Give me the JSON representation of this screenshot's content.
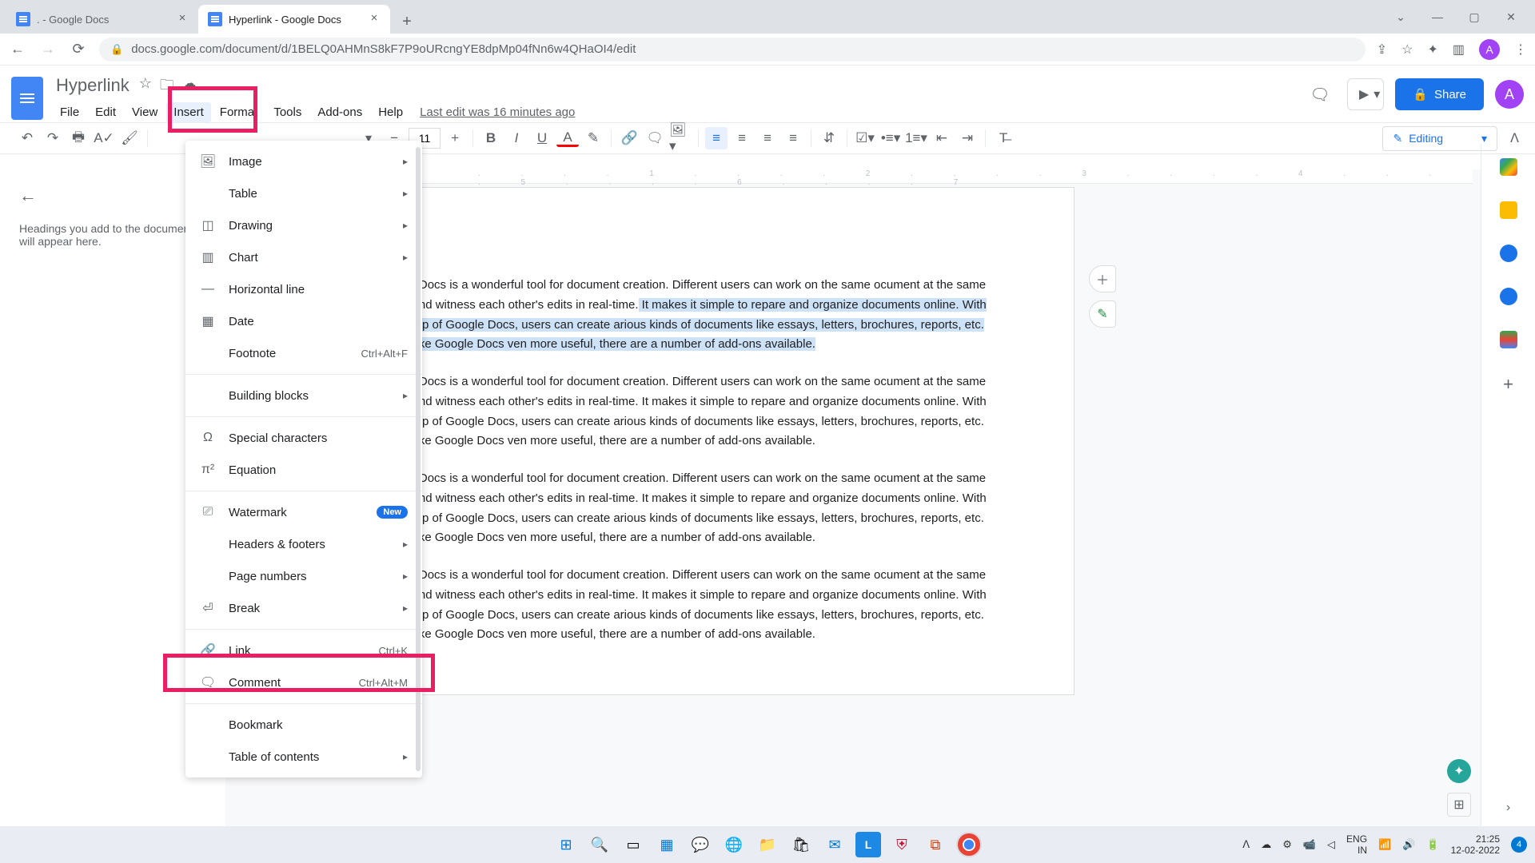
{
  "browser": {
    "tabs": [
      {
        "title": ". - Google Docs"
      },
      {
        "title": "Hyperlink - Google Docs"
      }
    ],
    "url": "docs.google.com/document/d/1BELQ0AHMnS8kF7P9oURcngYE8dpMp04fNn6w4QHaOI4/edit",
    "avatar_letter": "A"
  },
  "doc": {
    "title": "Hyperlink",
    "menus": [
      "File",
      "Edit",
      "View",
      "Insert",
      "Format",
      "Tools",
      "Add-ons",
      "Help"
    ],
    "active_menu_index": 3,
    "last_edit": "Last edit was 16 minutes ago",
    "share_label": "Share",
    "editing_label": "Editing",
    "outline_placeholder": "Headings you add to the document will appear here.",
    "font_size": "11",
    "avatar_letter": "A"
  },
  "insert_menu": {
    "items": [
      {
        "icon": "🖼",
        "label": "Image",
        "submenu": true
      },
      {
        "icon": "▦",
        "label": "Table",
        "submenu": true
      },
      {
        "icon": "⬚",
        "label": "Drawing",
        "submenu": true
      },
      {
        "icon": "📊",
        "label": "Chart",
        "submenu": true
      },
      {
        "icon": "—",
        "label": "Horizontal line"
      },
      {
        "icon": "📅",
        "label": "Date"
      },
      {
        "icon": "",
        "label": "Footnote",
        "shortcut": "Ctrl+Alt+F"
      }
    ],
    "sep1": true,
    "items2": [
      {
        "icon": "",
        "label": "Building blocks",
        "submenu": true
      }
    ],
    "sep2": true,
    "items3": [
      {
        "icon": "Ω",
        "label": "Special characters"
      },
      {
        "icon": "π²",
        "label": "Equation"
      }
    ],
    "sep3": true,
    "items4": [
      {
        "icon": "📄",
        "label": "Watermark",
        "badge": "New"
      },
      {
        "icon": "",
        "label": "Headers & footers",
        "submenu": true
      },
      {
        "icon": "",
        "label": "Page numbers",
        "submenu": true
      },
      {
        "icon": "⏎",
        "label": "Break",
        "submenu": true
      }
    ],
    "sep4": true,
    "items5": [
      {
        "icon": "🔗",
        "label": "Link",
        "shortcut": "Ctrl+K"
      },
      {
        "icon": "🗨",
        "label": "Comment",
        "shortcut": "Ctrl+Alt+M"
      }
    ],
    "sep5": true,
    "items6": [
      {
        "icon": "",
        "label": "Bookmark"
      },
      {
        "icon": "",
        "label": "Table of contents",
        "submenu": true
      }
    ]
  },
  "body": {
    "para_prefix_1": "oogle Docs is a wonderful tool for document creation. Different users can work on the same ocument at the same time and witness each other's edits in real-time.",
    "para_hl": " It makes it simple to repare and organize documents online. With the help of Google Docs, users can create arious kinds of documents like essays, letters, brochures, reports, etc. To make Google Docs ven more useful, there are a number of add-ons available.",
    "para_plain": "oogle Docs is a wonderful tool for document creation. Different users can work on the same ocument at the same time and witness each other's edits in real-time. It makes it simple to repare and organize documents online. With the help of Google Docs, users can create arious kinds of documents like essays, letters, brochures, reports, etc. To make Google Docs ven more useful, there are a number of add-ons available."
  },
  "taskbar": {
    "lang1": "ENG",
    "lang2": "IN",
    "time": "21:25",
    "date": "12-02-2022",
    "notif_count": "4"
  },
  "ruler_text": ". . . . 1 . . . . 2 . . . . 3 . . . . 4 . . . . 5 . . . . 6 . . . . 7"
}
